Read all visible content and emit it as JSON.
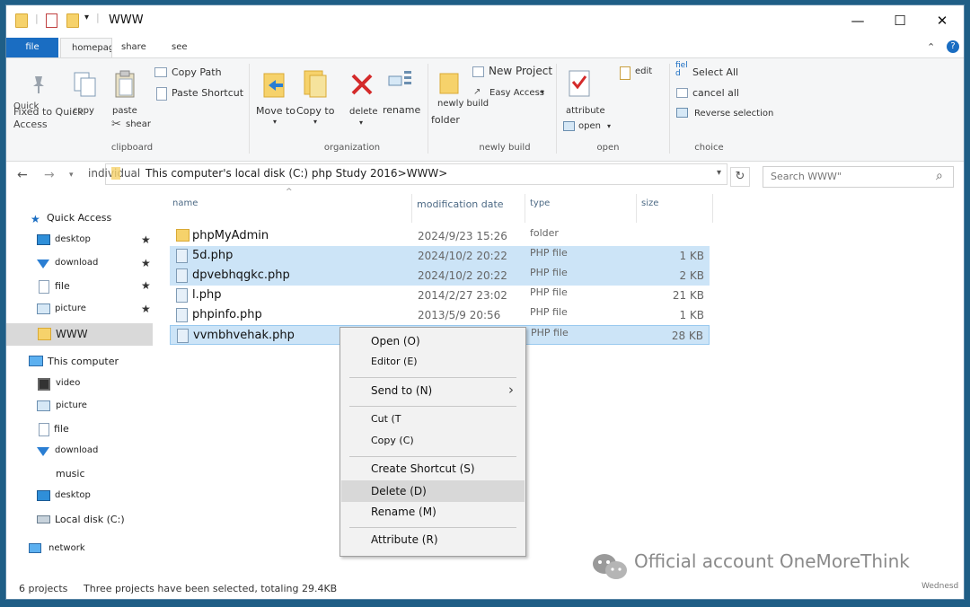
{
  "window": {
    "title": "WWW",
    "controls": {
      "minimize": "—",
      "maximize": "☐",
      "close": "✕"
    }
  },
  "tabs": {
    "file": "file",
    "home": "homepage",
    "share": "share",
    "view": "see"
  },
  "ribbon": {
    "clipboard": {
      "pin_label": "Fixed to Quick Access",
      "pin_overlap": "Quick",
      "copy": "copy",
      "paste": "paste",
      "copy_path": "Copy Path",
      "paste_shortcut": "Paste Shortcut",
      "cut": "shear",
      "group": "clipboard"
    },
    "organization": {
      "move_to": "Move to",
      "copy_to": "Copy to",
      "delete": "delete",
      "rename": "rename",
      "group": "organization"
    },
    "new": {
      "new_folder_line1": "newly build",
      "new_folder_line2": "folder",
      "new_project": "New Project",
      "easy_access": "Easy Access",
      "group": "newly build"
    },
    "open": {
      "properties": "attribute",
      "open": "open",
      "edit": "edit",
      "group": "open"
    },
    "select": {
      "select_all": "Select All",
      "select_all_icon_text": "fiel d",
      "select_none": "cancel all",
      "invert": "Reverse selection",
      "group": "choice"
    }
  },
  "address": {
    "prefix": "individual",
    "path": "This computer's local disk (C:) php Study 2016>WWW>",
    "search_placeholder": "Search WWW\""
  },
  "nav": {
    "quick_access": "Quick Access",
    "items": [
      {
        "label": "desktop",
        "pinned": "★"
      },
      {
        "label": "download",
        "pinned": "★"
      },
      {
        "label": "file",
        "pinned": "★"
      },
      {
        "label": "picture",
        "pinned": "★"
      }
    ],
    "current": "WWW",
    "this_pc": "This computer",
    "pc_items": [
      "video",
      "picture",
      "file",
      "download",
      "music",
      "desktop",
      "Local disk (C:)"
    ],
    "network": "network"
  },
  "columns": {
    "name": "name",
    "date": "modification date",
    "type": "type",
    "size": "size"
  },
  "files": [
    {
      "name": "phpMyAdmin",
      "date": "2024/9/23 15:26",
      "type": "folder",
      "size": ""
    },
    {
      "name": "5d.php",
      "date": "2024/10/2 20:22",
      "type": "PHP file",
      "size": "1 KB"
    },
    {
      "name": "dpvebhqgkc.php",
      "date": "2024/10/2 20:22",
      "type": "PHP file",
      "size": "2 KB"
    },
    {
      "name": "l.php",
      "date": "2014/2/27 23:02",
      "type": "PHP file",
      "size": "21 KB"
    },
    {
      "name": "phpinfo.php",
      "date": "2013/5/9 20:56",
      "type": "PHP file",
      "size": "1 KB"
    },
    {
      "name": "vvmbhvehak.php",
      "date": "",
      "type": "PHP file",
      "size": "28 KB"
    }
  ],
  "context_menu": {
    "open": "Open (O)",
    "editor": "Editor (E)",
    "send_to": "Send to (N)",
    "cut": "Cut (T",
    "copy": "Copy (C)",
    "create_shortcut": "Create Shortcut (S)",
    "delete": "Delete (D)",
    "rename": "Rename (M)",
    "attribute": "Attribute (R)"
  },
  "status": {
    "count": "6 projects",
    "selection": "Three projects have been selected, totaling 29.4KB"
  },
  "watermark": "Official account OneMoreThink",
  "taskbar_day": "Wednesd"
}
